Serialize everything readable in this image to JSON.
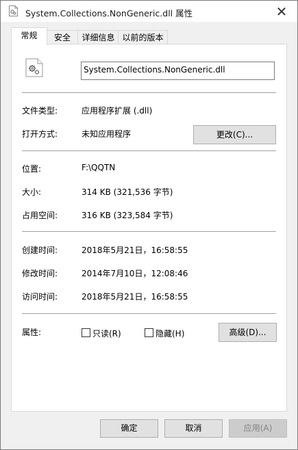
{
  "window": {
    "title": "System.Collections.NonGeneric.dll 属性",
    "close_glyph": "✕"
  },
  "tabs": [
    {
      "label": "常规",
      "active": true
    },
    {
      "label": "安全",
      "active": false
    },
    {
      "label": "详细信息",
      "active": false
    },
    {
      "label": "以前的版本",
      "active": false
    }
  ],
  "general": {
    "filename": "System.Collections.NonGeneric.dll",
    "file_type_label": "文件类型:",
    "file_type_value": "应用程序扩展 (.dll)",
    "opens_with_label": "打开方式:",
    "opens_with_value": "未知应用程序",
    "change_button": "更改(C)...",
    "location_label": "位置:",
    "location_value": "F:\\QQTN",
    "size_label": "大小:",
    "size_value": "314 KB (321,536 字节)",
    "size_on_disk_label": "占用空间:",
    "size_on_disk_value": "316 KB (323,584 字节)",
    "created_label": "创建时间:",
    "created_value": "2018年5月21日，16:58:55",
    "modified_label": "修改时间:",
    "modified_value": "2014年7月10日，12:08:46",
    "accessed_label": "访问时间:",
    "accessed_value": "2018年5月21日，16:58:55",
    "attributes_label": "属性:",
    "readonly_label": "只读(R)",
    "readonly_checked": false,
    "hidden_label": "隐藏(H)",
    "hidden_checked": false,
    "advanced_button": "高级(D)..."
  },
  "footer": {
    "ok_button": "确定",
    "cancel_button": "取消",
    "apply_button": "应用(A)",
    "apply_enabled": false
  },
  "icons": {
    "title": "dll-file-icon",
    "file": "dll-gears-file-icon"
  }
}
